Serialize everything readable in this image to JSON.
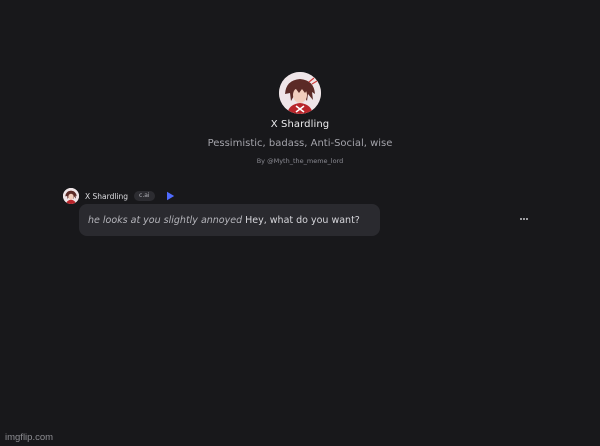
{
  "character": {
    "name": "X Shardling",
    "description": "Pessimistic, badass, Anti-Social, wise",
    "author": "By @Myth_the_meme_lord"
  },
  "message": {
    "sender": "X Shardling",
    "badge": "c.ai",
    "action_text": "he looks at you slightly annoyed",
    "text": "Hey, what do you want?"
  },
  "icons": {
    "play": "play-icon",
    "more": "more-options-icon"
  },
  "colors": {
    "background": "#18181b",
    "bubble": "#2a2a2f",
    "accent": "#4f6bff"
  },
  "watermark": "imgflip.com"
}
